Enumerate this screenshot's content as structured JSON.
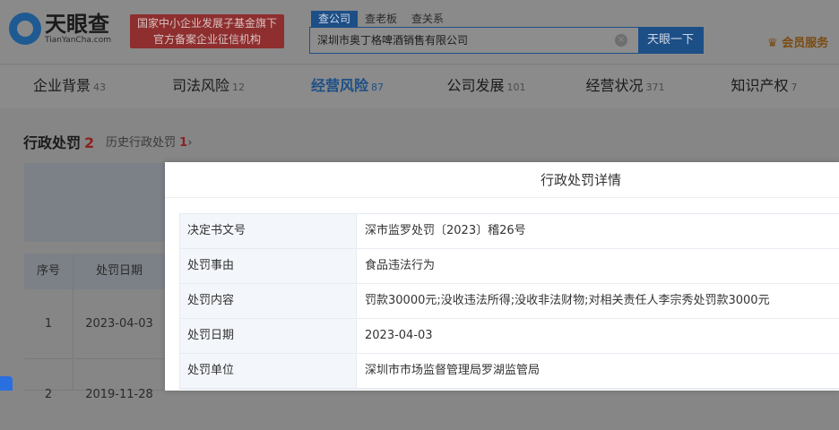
{
  "header": {
    "logo_cn": "天眼查",
    "logo_en": "TianYanCha.com",
    "badge_line1": "国家中小企业发展子基金旗下",
    "badge_line2": "官方备案企业征信机构",
    "search_tabs": [
      "查公司",
      "查老板",
      "查关系"
    ],
    "search_value": "深圳市奥丁格啤酒销售有限公司",
    "search_button": "天眼一下",
    "vip": "会员服务"
  },
  "nav": [
    {
      "label": "企业背景",
      "count": "43"
    },
    {
      "label": "司法风险",
      "count": "12"
    },
    {
      "label": "经营风险",
      "count": "87"
    },
    {
      "label": "公司发展",
      "count": "101"
    },
    {
      "label": "经营状况",
      "count": "371"
    },
    {
      "label": "知识产权",
      "count": "7"
    }
  ],
  "section": {
    "title": "行政处罚",
    "count": "2",
    "history_label": "历史行政处罚",
    "history_count": "1"
  },
  "bg_table": {
    "headers": [
      "序号",
      "处罚日期"
    ],
    "rows": [
      [
        "1",
        "2023-04-03"
      ],
      [
        "2",
        "2019-11-28"
      ]
    ]
  },
  "modal": {
    "title": "行政处罚详情",
    "rows": [
      {
        "label": "决定书文号",
        "value": "深市监罗处罚〔2023〕稽26号"
      },
      {
        "label": "处罚事由",
        "value": "食品违法行为"
      },
      {
        "label": "处罚内容",
        "value": "罚款30000元;没收违法所得;没收非法财物;对相关责任人李宗秀处罚款3000元"
      },
      {
        "label": "处罚日期",
        "value": "2023-04-03"
      },
      {
        "label": "处罚单位",
        "value": "深圳市市场监督管理局罗湖监管局"
      }
    ]
  }
}
